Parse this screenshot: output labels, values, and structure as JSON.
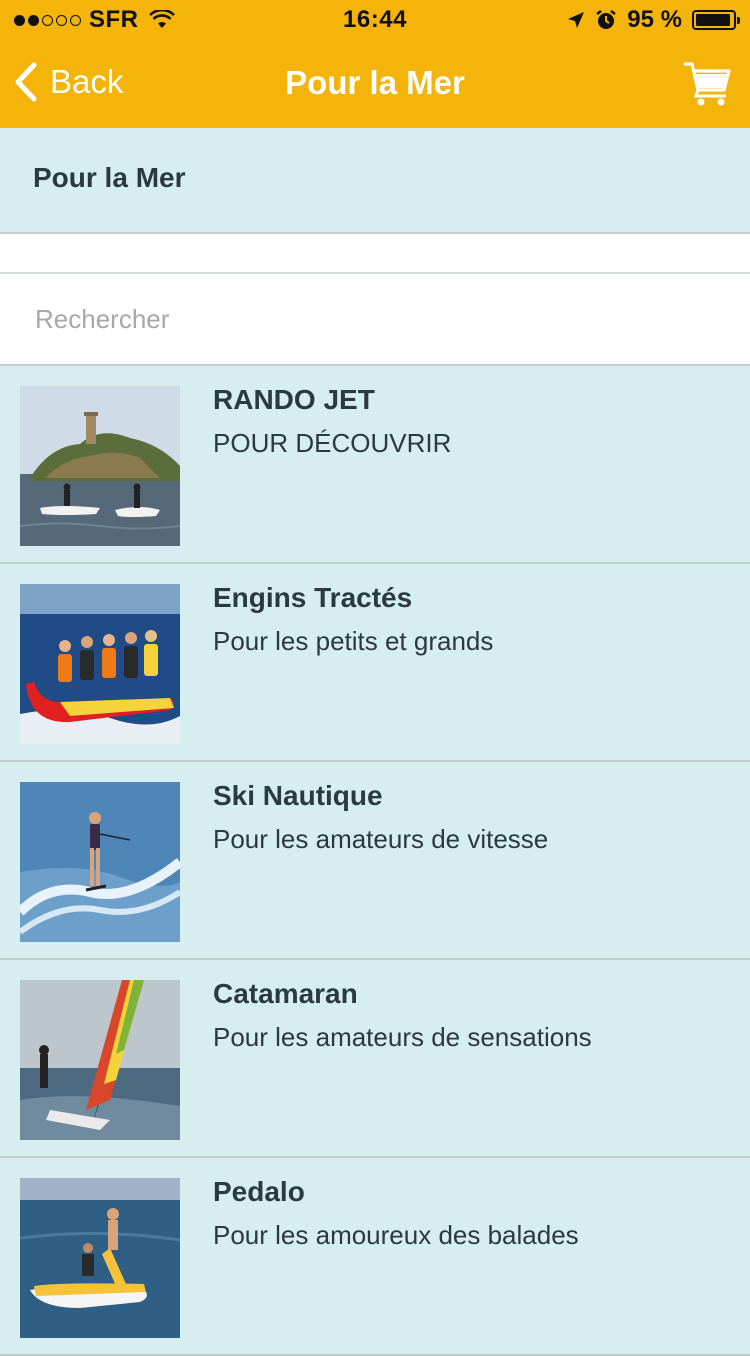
{
  "status_bar": {
    "carrier": "SFR",
    "time": "16:44",
    "battery_percent": "95 %",
    "battery_level": 0.95,
    "signal_bars_filled": 2,
    "signal_bars_total": 5
  },
  "nav": {
    "back_label": "Back",
    "title": "Pour la Mer",
    "cart_icon": "cart-icon"
  },
  "section": {
    "title": "Pour la Mer"
  },
  "search": {
    "placeholder": "Rechercher",
    "value": ""
  },
  "items": [
    {
      "title": "RANDO JET",
      "subtitle": "POUR DÉCOUVRIR",
      "image": "jet-ski photo"
    },
    {
      "title": "Engins Tractés",
      "subtitle": "Pour les petits et grands",
      "image": "banana boat photo"
    },
    {
      "title": "Ski Nautique",
      "subtitle": "Pour les amateurs de vitesse",
      "image": "water ski photo"
    },
    {
      "title": "Catamaran",
      "subtitle": "Pour les amateurs de sensations",
      "image": "catamaran photo"
    },
    {
      "title": "Pedalo",
      "subtitle": "Pour les amoureux des balades",
      "image": "pedalo photo"
    }
  ],
  "colors": {
    "accent": "#f5b40a",
    "list_background": "#d6eef0",
    "text": "#2a3a40"
  }
}
